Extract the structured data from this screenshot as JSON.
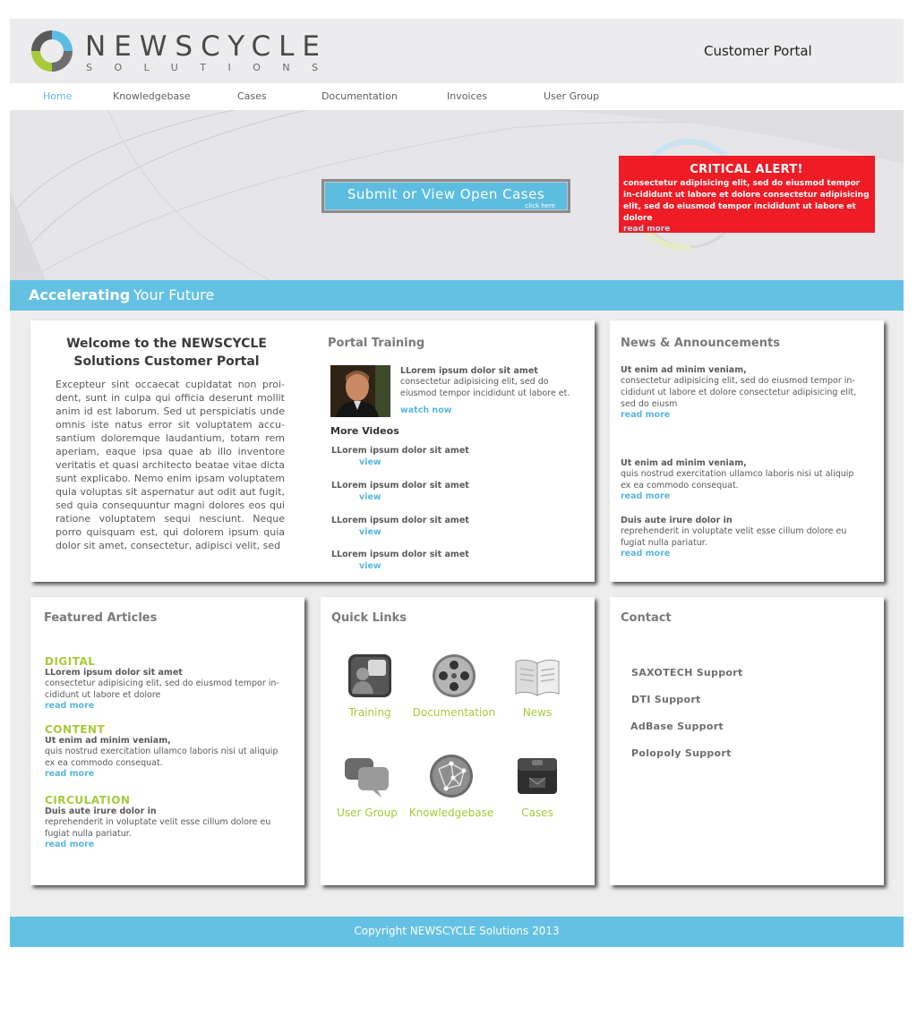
{
  "brand": {
    "name": "NEWSCYCLE",
    "sub": "SOLUTIONS",
    "colors": {
      "accent": "#65c1e3",
      "green": "#a9c93a",
      "alert": "#ee1c25"
    }
  },
  "header": {
    "portal_title": "Customer Portal"
  },
  "nav": {
    "items": [
      {
        "label": "Home",
        "active": true
      },
      {
        "label": "Knowledgebase",
        "active": false
      },
      {
        "label": "Cases",
        "active": false
      },
      {
        "label": "Documentation",
        "active": false
      },
      {
        "label": "Invoices",
        "active": false
      },
      {
        "label": "User Group",
        "active": false
      }
    ]
  },
  "hero": {
    "button_label": "Submit or View Open Cases",
    "button_sub": "click here",
    "alert": {
      "title": "CRITICAL ALERT!",
      "body": "consectetur adipisicing elit, sed do eiusmod tempor in-cididunt ut labore et dolore consectetur adipisicing elit, sed do eiusmod tempor incididunt ut labore et dolore",
      "link": "read more"
    }
  },
  "tagline": {
    "bold": "Accelerating",
    "rest": "Your Future"
  },
  "welcome": {
    "title": "Welcome to the NEWSCYCLE Solutions Customer Portal",
    "body": "Excepteur sint occaecat cupidatat non proi-dent, sunt in culpa qui officia deserunt mollit anim id est laborum. Sed ut perspiciatis unde omnis iste natus error sit voluptatem accu-santium doloremque laudantium, totam rem aperiam, eaque ipsa quae ab illo inventore veritatis et quasi architecto beatae vitae dicta sunt explicabo. Nemo enim ipsam voluptatem quia voluptas sit aspernatur aut odit aut fugit, sed quia consequuntur magni dolores eos qui ratione voluptatem sequi nesciunt. Neque porro quisquam est, qui dolorem ipsum quia dolor sit amet, consectetur, adipisci velit, sed"
  },
  "training": {
    "heading": "Portal Training",
    "featured_title": "LLorem ipsum dolor sit amet",
    "featured_body": "consectetur adipisicing elit, sed do eiusmod tempor incididunt ut labore et.",
    "featured_link": "watch now",
    "videos_heading": "More Videos",
    "videos": [
      {
        "title": "LLorem ipsum dolor sit amet",
        "link": "view"
      },
      {
        "title": "LLorem ipsum dolor sit amet",
        "link": "view"
      },
      {
        "title": "LLorem ipsum dolor sit amet",
        "link": "view"
      },
      {
        "title": "LLorem ipsum dolor sit amet",
        "link": "view"
      }
    ]
  },
  "news": {
    "heading": "News & Announcements",
    "items": [
      {
        "title": "Ut enim ad minim veniam,",
        "body": "consectetur adipisicing elit, sed do eiusmod tempor in-cididunt ut labore et dolore consectetur adipisicing elit, sed do eiusm",
        "link": "read more"
      },
      {
        "title": "Ut enim ad minim veniam,",
        "body": "quis nostrud exercitation ullamco laboris nisi ut aliquip ex ea commodo consequat.",
        "link": "read more"
      },
      {
        "title": "Duis aute irure dolor in",
        "body": "reprehenderit in voluptate velit esse cillum dolore eu fugiat nulla pariatur.",
        "link": "read more"
      }
    ]
  },
  "featured": {
    "heading": "Featured Articles",
    "items": [
      {
        "category": "DIGITAL",
        "title": "LLorem ipsum dolor sit amet",
        "body": "consectetur adipisicing elit, sed do eiusmod tempor in-cididunt ut labore et dolore",
        "link": "read more"
      },
      {
        "category": "CONTENT",
        "title": "Ut enim ad minim veniam,",
        "body": "quis nostrud exercitation ullamco laboris nisi ut aliquip ex ea commodo consequat.",
        "link": "read more"
      },
      {
        "category": "CIRCULATION",
        "title": "Duis aute irure dolor in",
        "body": "reprehenderit in voluptate velit esse cillum dolore eu fugiat nulla pariatur.",
        "link": "read more"
      }
    ]
  },
  "quick_links": {
    "heading": "Quick Links",
    "items": [
      {
        "label": "Training",
        "icon": "training-icon"
      },
      {
        "label": "Documentation",
        "icon": "film-reel-icon"
      },
      {
        "label": "News",
        "icon": "book-icon"
      },
      {
        "label": "User Group",
        "icon": "chat-bubbles-icon"
      },
      {
        "label": "Knowledgebase",
        "icon": "globe-network-icon"
      },
      {
        "label": "Cases",
        "icon": "case-box-icon"
      }
    ]
  },
  "contact": {
    "heading": "Contact",
    "links": [
      "SAXOTECH Support",
      "DTI Support",
      "AdBase Support",
      "Polopoly Support"
    ]
  },
  "footer": {
    "copyright": "Copyright NEWSCYCLE Solutions 2013"
  }
}
